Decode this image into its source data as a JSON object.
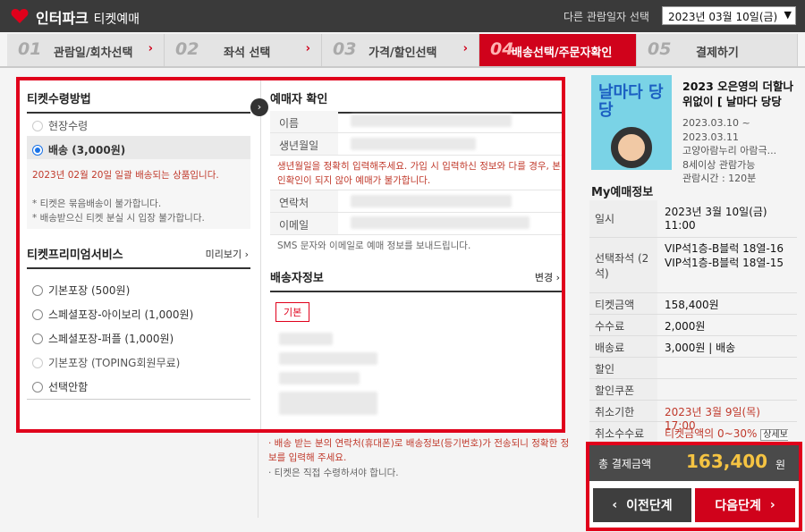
{
  "topbar": {
    "logo": "인터파크",
    "service": "티켓예매",
    "date_label": "다른 관람일자 선택",
    "date_value": "2023년 03월 10일(금)"
  },
  "steps": [
    {
      "num": "01",
      "label": "관람일/회차선택"
    },
    {
      "num": "02",
      "label": "좌석 선택"
    },
    {
      "num": "03",
      "label": "가격/할인선택"
    },
    {
      "num": "04",
      "label": "배송선택/주문자확인"
    },
    {
      "num": "05",
      "label": "결제하기"
    }
  ],
  "ticket_method": {
    "title": "티켓수령방법",
    "options": [
      "현장수령",
      "배송 (3,000원)"
    ],
    "selected_note": "2023년 02월 20일 일괄 배송되는 상품입니다.",
    "notes": [
      "* 티켓은 묶음배송이 불가합니다.",
      "* 배송받으신 티켓 분실 시 입장 불가합니다."
    ]
  },
  "premium": {
    "title": "티켓프리미엄서비스",
    "preview": "미리보기",
    "options": [
      "기본포장 (500원)",
      "스페셜포장-아이보리 (1,000원)",
      "스페셜포장-퍼플 (1,000원)",
      "기본포장 (TOPING회원무료)",
      "선택안함"
    ]
  },
  "booker": {
    "title": "예매자 확인",
    "name_label": "이름",
    "birth_label": "생년월일",
    "birth_note": "생년월일을 정확히 입력해주세요. 가입 시 입력하신 정보와 다를 경우, 본인확인이 되지 않아 예매가 불가합니다.",
    "phone_label": "연락처",
    "email_label": "이메일",
    "sms_note": "SMS 문자와 이메일로 예매 정보를 보내드립니다."
  },
  "shipping": {
    "title": "배송자정보",
    "change": "변경",
    "default_tag": "기본",
    "notes": [
      "· 배송 받는 분의 연락처(휴대폰)로 배송정보(등기번호)가 전송되니 정확한 정보를 입력해 주세요.",
      "· 티켓은 직접 수령하셔야 합니다."
    ]
  },
  "show": {
    "poster_text": "날마다 당당",
    "title": "2023 오은영의 더할나위없이 [ 날마다 당당",
    "dates": "2023.03.10 ~ 2023.03.11",
    "venue": "고양아람누리 아람극...",
    "age": "8세이상 관람가능",
    "runtime": "관람시간 : 120분"
  },
  "my": {
    "title": "My예매정보",
    "rows": [
      {
        "k": "일시",
        "v": "2023년 3월 10일(금) 11:00"
      },
      {
        "k": "선택좌석 (2석)",
        "v": "VIP석1층-B블럭 18열-16 VIP석1층-B블럭 18열-15"
      },
      {
        "k": "티켓금액",
        "v": "158,400원"
      },
      {
        "k": "수수료",
        "v": "2,000원"
      },
      {
        "k": "배송료",
        "v": "3,000원 | 배송"
      },
      {
        "k": "할인",
        "v": ""
      },
      {
        "k": "할인쿠폰",
        "v": ""
      },
      {
        "k": "취소기한",
        "v": "2023년 3월 9일(목) 17:00"
      },
      {
        "k": "취소수수료",
        "v": "티켓금액의 0~30%"
      }
    ],
    "detail_btn": "상세보기"
  },
  "total": {
    "label": "총 결제금액",
    "value": "163,400",
    "unit": "원"
  },
  "nav": {
    "prev": "이전단계",
    "next": "다음단계"
  }
}
